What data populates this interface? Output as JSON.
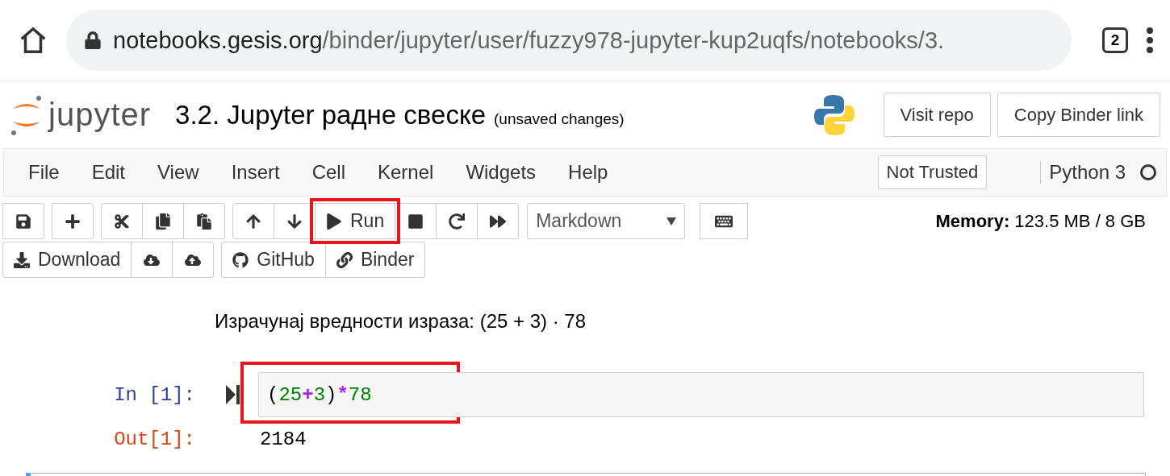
{
  "browser": {
    "url_domain": "notebooks.gesis.org",
    "url_path": "/binder/jupyter/user/fuzzy978-jupyter-kup2uqfs/notebooks/3.",
    "tab_count": "2"
  },
  "header": {
    "logo_text": "jupyter",
    "title": "3.2. Jupyter радне свеске",
    "status": "(unsaved changes)",
    "buttons": [
      "Visit repo",
      "Copy Binder link"
    ]
  },
  "menubar": {
    "items": [
      "File",
      "Edit",
      "View",
      "Insert",
      "Cell",
      "Kernel",
      "Widgets",
      "Help"
    ],
    "trust": "Not Trusted",
    "kernel": "Python 3",
    "kernel_busy": false
  },
  "toolbar": {
    "row_1": [
      {
        "buttons": [
          {
            "highlighted": false
          }
        ]
      },
      {
        "buttons": [
          {
            "highlighted": false
          }
        ]
      },
      {
        "buttons": [
          {
            "highlighted": false
          },
          {
            "highlighted": false
          },
          {
            "highlighted": false
          }
        ]
      },
      {
        "buttons": [
          {
            "highlighted": false
          },
          {
            "highlighted": false
          },
          {
            "label": "Run",
            "highlighted": true
          },
          {
            "highlighted": false
          },
          {
            "highlighted": false
          },
          {
            "highlighted": false
          }
        ]
      }
    ],
    "cell_type": "Markdown",
    "memory_label": "Memory:",
    "memory_value": "123.5 MB / 8 GB",
    "row_2": [
      {
        "buttons": [
          {
            "label": "Download",
            "highlighted": false
          },
          {
            "highlighted": false
          },
          {
            "highlighted": false
          }
        ]
      },
      {
        "buttons": [
          {
            "label": "GitHub",
            "highlighted": false
          },
          {
            "label": "Binder",
            "highlighted": false
          }
        ]
      }
    ]
  },
  "cells": [
    {
      "kind": "markdown",
      "text": "Израчунај вредности израза: (25 + 3) · 78"
    },
    {
      "kind": "code",
      "prompt": "In [1]:",
      "highlighted": true,
      "tokens": [
        {
          "kind": "paren",
          "text": "("
        },
        {
          "kind": "number",
          "text": "25"
        },
        {
          "kind": "operator",
          "text": "+"
        },
        {
          "kind": "number",
          "text": "3"
        },
        {
          "kind": "paren",
          "text": ")"
        },
        {
          "kind": "operator",
          "text": "*"
        },
        {
          "kind": "number",
          "text": "78"
        }
      ],
      "out_prompt": "Out[1]:",
      "output": "2184"
    },
    {
      "kind": "empty",
      "selected": true
    }
  ]
}
